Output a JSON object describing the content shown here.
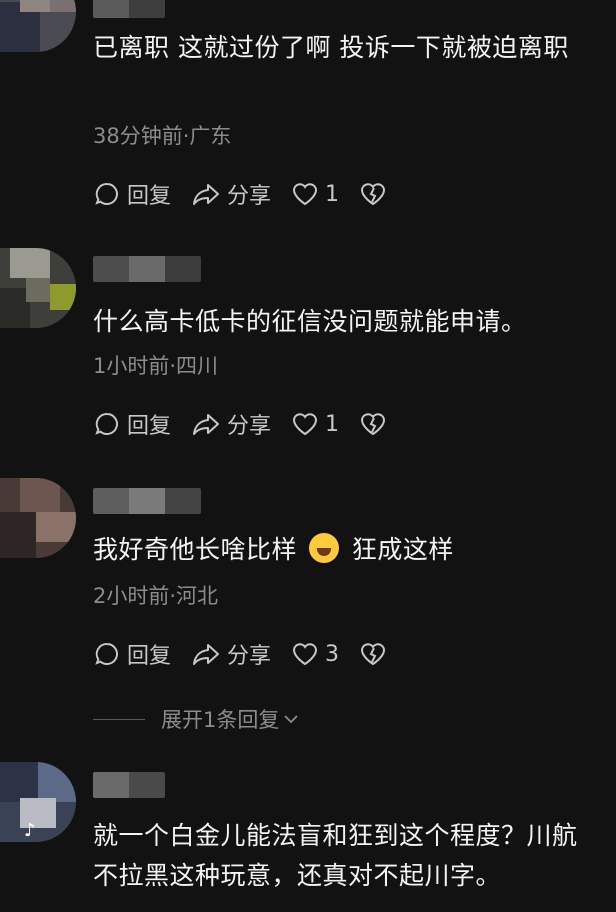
{
  "comments": [
    {
      "text": "已离职  这就过份了啊   投诉一下就被迫离职",
      "meta": "38分钟前·广东",
      "reply_label": "回复",
      "share_label": "分享",
      "like_count": "1"
    },
    {
      "text": "什么高卡低卡的征信没问题就能申请。",
      "meta": "1小时前·四川",
      "reply_label": "回复",
      "share_label": "分享",
      "like_count": "1"
    },
    {
      "text_before": "我好奇他长啥比样",
      "emoji": "laughing-crying-emoji",
      "text_after": "狂成这样",
      "meta": "2小时前·河北",
      "reply_label": "回复",
      "share_label": "分享",
      "like_count": "3"
    },
    {
      "text": "就一个白金儿能法盲和狂到这个程度？川航不拉黑这种玩意，还真对不起川字。"
    }
  ],
  "expand_replies": "展开1条回复",
  "colors": {
    "background": "#121212",
    "text": "#f4f4f4",
    "meta": "#8c8c8c"
  }
}
